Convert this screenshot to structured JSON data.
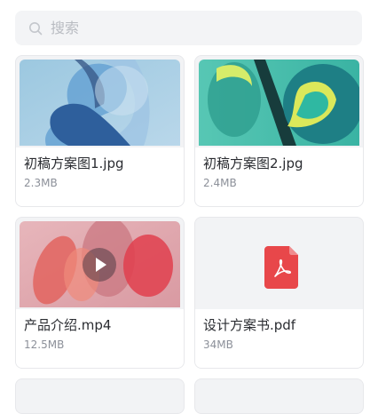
{
  "search": {
    "placeholder": "搜索"
  },
  "files": [
    {
      "name": "初稿方案图1.jpg",
      "size": "2.3MB",
      "type": "image",
      "icon": "image-thumbnail"
    },
    {
      "name": "初稿方案图2.jpg",
      "size": "2.4MB",
      "type": "image",
      "icon": "image-thumbnail"
    },
    {
      "name": "产品介绍.mp4",
      "size": "12.5MB",
      "type": "video",
      "icon": "play-icon"
    },
    {
      "name": "设计方案书.pdf",
      "size": "34MB",
      "type": "pdf",
      "icon": "pdf-icon"
    }
  ],
  "colors": {
    "pdf_red": "#e8474a",
    "card_bg": "#f2f3f5",
    "search_bg": "#f3f4f6"
  }
}
